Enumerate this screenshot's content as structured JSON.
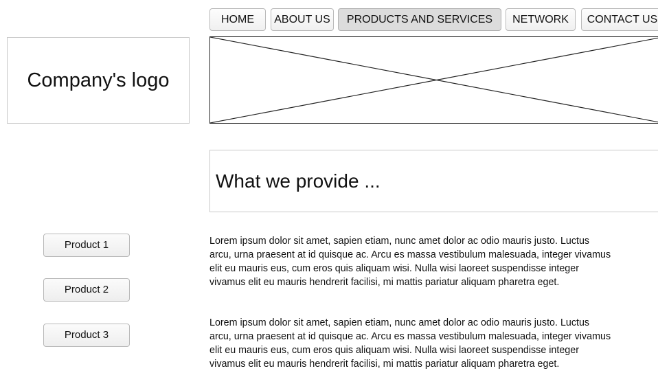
{
  "nav": {
    "items": [
      {
        "label": "HOME",
        "active": false
      },
      {
        "label": "ABOUT US",
        "active": false
      },
      {
        "label": "PRODUCTS AND SERVICES",
        "active": true
      },
      {
        "label": "NETWORK",
        "active": false
      },
      {
        "label": "CONTACT US",
        "active": false
      }
    ]
  },
  "logo": {
    "text": "Company's logo"
  },
  "headline": {
    "text": "What we provide ..."
  },
  "sidebar": {
    "buttons": [
      {
        "label": "Product 1"
      },
      {
        "label": "Product 2"
      },
      {
        "label": "Product 3"
      }
    ]
  },
  "content": {
    "paragraphs": [
      {
        "lines": [
          "Lorem ipsum dolor sit amet, sapien etiam, nunc amet dolor ac odio mauris justo. Luctus",
          "arcu, urna praesent at id quisque ac. Arcu es massa vestibulum malesuada, integer vivamus",
          "elit eu mauris eus, cum eros quis aliquam wisi. Nulla wisi laoreet suspendisse integer",
          "vivamus elit eu mauris hendrerit facilisi, mi mattis pariatur aliquam pharetra eget."
        ]
      },
      {
        "lines": [
          "Lorem ipsum dolor sit amet, sapien etiam, nunc amet dolor ac odio mauris justo. Luctus",
          "arcu, urna praesent at id quisque ac. Arcu es massa vestibulum malesuada, integer vivamus",
          "elit eu mauris eus, cum eros quis aliquam wisi. Nulla wisi laoreet suspendisse integer",
          "vivamus elit eu mauris hendrerit facilisi, mi mattis pariatur aliquam pharetra eget."
        ]
      }
    ]
  }
}
